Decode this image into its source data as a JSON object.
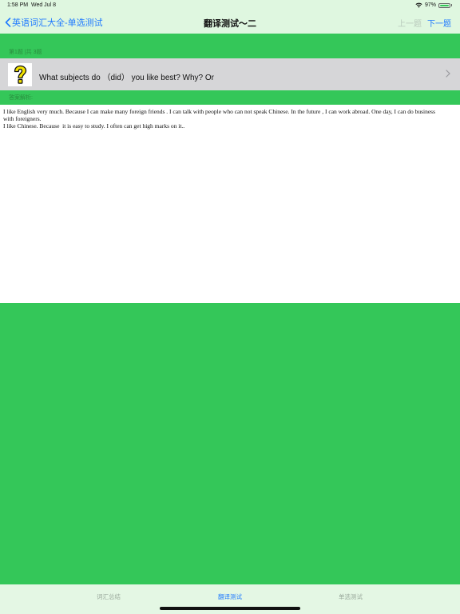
{
  "status_bar": {
    "time": "1:58 PM",
    "date": "Wed Jul 8",
    "battery": "97%",
    "battery_level": 0.97,
    "wifi_icon": "wifi-icon"
  },
  "nav": {
    "back_label": "英语词汇大全-单选测试",
    "title": "翻译测试～二",
    "prev_label": "上一题",
    "next_label": "下一题"
  },
  "question": {
    "count_label": "第1题 |共 3题",
    "text": "What subjects do （did） you like best?   Why?   Or",
    "icon": "question-mark-icon"
  },
  "answer": {
    "label": "答案解析:",
    "text": "I like English very much. Because I can make many foreign friends . I can talk with people who can not speak Chinese. In the future , I can work abroad. One day, I can do business\nwith foreigners.\nI like Chinese. Because  it is easy to study. I often can get high marks on it.."
  },
  "tabs": [
    {
      "label": "词汇总结",
      "active": false
    },
    {
      "label": "翻译测试",
      "active": true
    },
    {
      "label": "单选测试",
      "active": false
    }
  ],
  "colors": {
    "green": "#34c759",
    "accent": "#1f7aff",
    "background": "#dff7e0"
  }
}
